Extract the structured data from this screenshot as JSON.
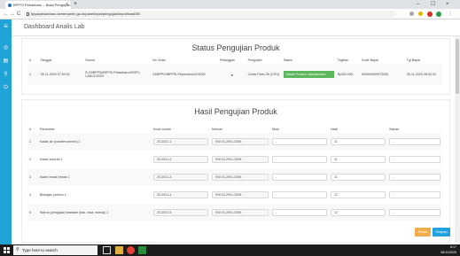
{
  "browser": {
    "tab_title": "BPPSI Pekanbaru – Balai Pengujian",
    "tab_close": "×",
    "new_tab": "+",
    "url": "bppsipekanbaru.kemenperin.go.id/panel/bpsi/pengujian/input/hasil/55",
    "back": "←",
    "forward": "→",
    "reload": "C",
    "minimize": "–",
    "restore": "☐",
    "close": "×",
    "menu": "⋮"
  },
  "app": {
    "title": "Dashboard Analis Lab",
    "menu_icon": "≡",
    "nav_icons": [
      "◎",
      "▤",
      "⚲",
      "⏻"
    ]
  },
  "status_section": {
    "title": "Status Pengujian Produk",
    "headers": [
      "#",
      "Tanggal",
      "Nomor",
      "No Order",
      "Pelanggan",
      "Pengujian",
      "Status",
      "Tagihan",
      "Kode Bayar",
      "Tgl Bayar"
    ],
    "row": {
      "index": "1",
      "tanggal": "05-11-2020 07:53:52",
      "nomor": "R.23/BPPSI/BPPSI-Pekanbaru/XI/SPI-LAB/11/2020",
      "no_order": "23/BPPSI/BPPSI-Pekanbaru/11/2020",
      "pelanggan": "●",
      "pengujian": "Crude Palm Oil (CPO)",
      "status": "Dalam Proses Laboratorium",
      "tagihan": "Rp320.000",
      "kode_bayar": "820000909972000",
      "tgl_bayar": "05-11-2020 08:53:20"
    }
  },
  "result_section": {
    "title": "Hasil Pengujian Produk",
    "headers": [
      "#",
      "Parameter",
      "Kode contoh",
      "Metode",
      "Mutu",
      "Hasil",
      "Satuan"
    ],
    "rows": [
      {
        "no": "1",
        "parameter": "Kadar air (condem semen) 1",
        "kode": "20-0021-1",
        "metode": "SNI 01-2901-2006",
        "mutu": "-",
        "hasil": "11",
        "satuan": "-"
      },
      {
        "no": "2",
        "parameter": "Kadar kotoran 1",
        "kode": "20-0021-2",
        "metode": "SNI 01-2901-2006",
        "mutu": "-",
        "hasil": "11",
        "satuan": "-"
      },
      {
        "no": "3",
        "parameter": "Asam lemak bebas 1",
        "kode": "20-0021-3",
        "metode": "SNI 01-2901-2006",
        "mutu": "-",
        "hasil": "11",
        "satuan": "-"
      },
      {
        "no": "4",
        "parameter": "Bilangan yodium 1",
        "kode": "20-0021-4",
        "metode": "SNI 01-2901-2006",
        "mutu": "-",
        "hasil": "12",
        "satuan": "-"
      },
      {
        "no": "5",
        "parameter": "Warna (pengujian keadaan (bau, rasa, warna)) 1",
        "kode": "20-0021-5",
        "metode": "SNI 01-2901-2006",
        "mutu": "-",
        "hasil": "12",
        "satuan": "-"
      }
    ],
    "reset_label": "Reset",
    "save_label": "Simpan"
  },
  "taskbar": {
    "search_placeholder": "Type here to search",
    "time": "8:17",
    "date": "06/11/2020"
  },
  "colors": {
    "sidebar": "#20a4d8",
    "status_green": "#5cb85c",
    "reset_orange": "#f0ad4e",
    "save_blue": "#1fa2df"
  }
}
